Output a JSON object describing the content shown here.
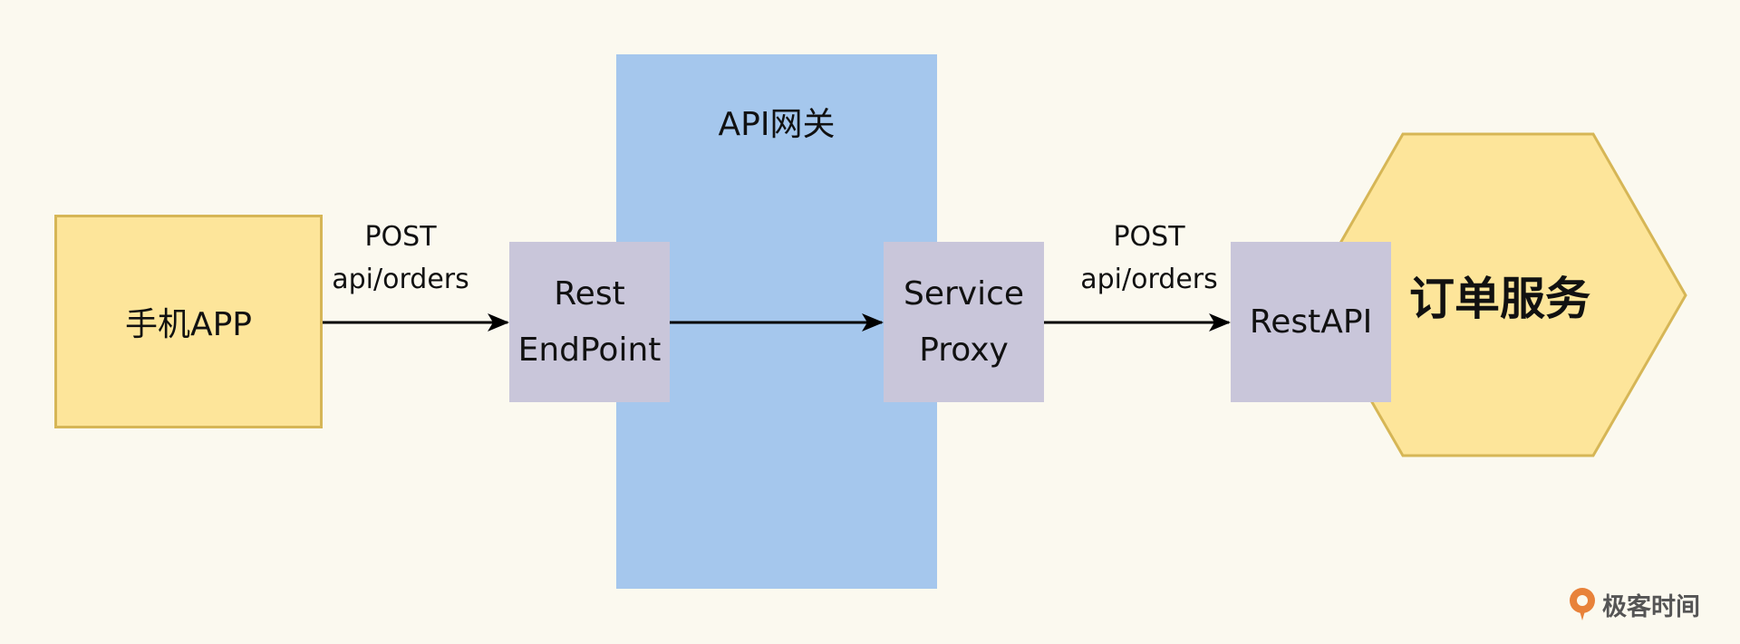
{
  "diagram": {
    "gateway_label": "API网关",
    "client_label": "手机APP",
    "rest_endpoint_label": "Rest\nEndPoint",
    "service_proxy_label": "Service\nProxy",
    "restapi_label": "RestAPI",
    "order_service_label": "订单服务",
    "arrow1_label": "POST\napi/orders",
    "arrow2_label": "POST\napi/orders"
  },
  "watermark": {
    "text": "极客时间"
  },
  "colors": {
    "background": "#fbf9ef",
    "gateway_fill": "#a5c7ed",
    "yellow_fill": "#fde59a",
    "yellow_stroke": "#d6b656",
    "purple_fill": "#c9c6da",
    "arrow": "#000000",
    "logo_orange": "#e8823a"
  }
}
